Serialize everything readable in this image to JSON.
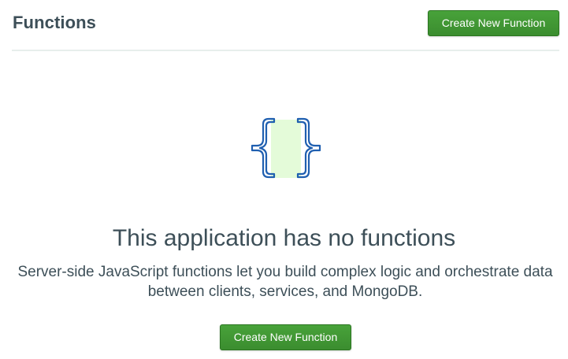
{
  "header": {
    "title": "Functions",
    "create_button_label": "Create New Function"
  },
  "empty_state": {
    "icon": "curly-braces-icon",
    "title": "This application has no functions",
    "description": "Server-side JavaScript functions let you build complex logic and orchestrate data between clients, services, and MongoDB.",
    "create_button_label": "Create New Function"
  },
  "colors": {
    "primary_button": "#3b8d2f",
    "icon_stroke": "#1f5fb0",
    "icon_fill": "#e4fbd9",
    "divider": "#e7eeec",
    "text": "#3d4f58"
  }
}
